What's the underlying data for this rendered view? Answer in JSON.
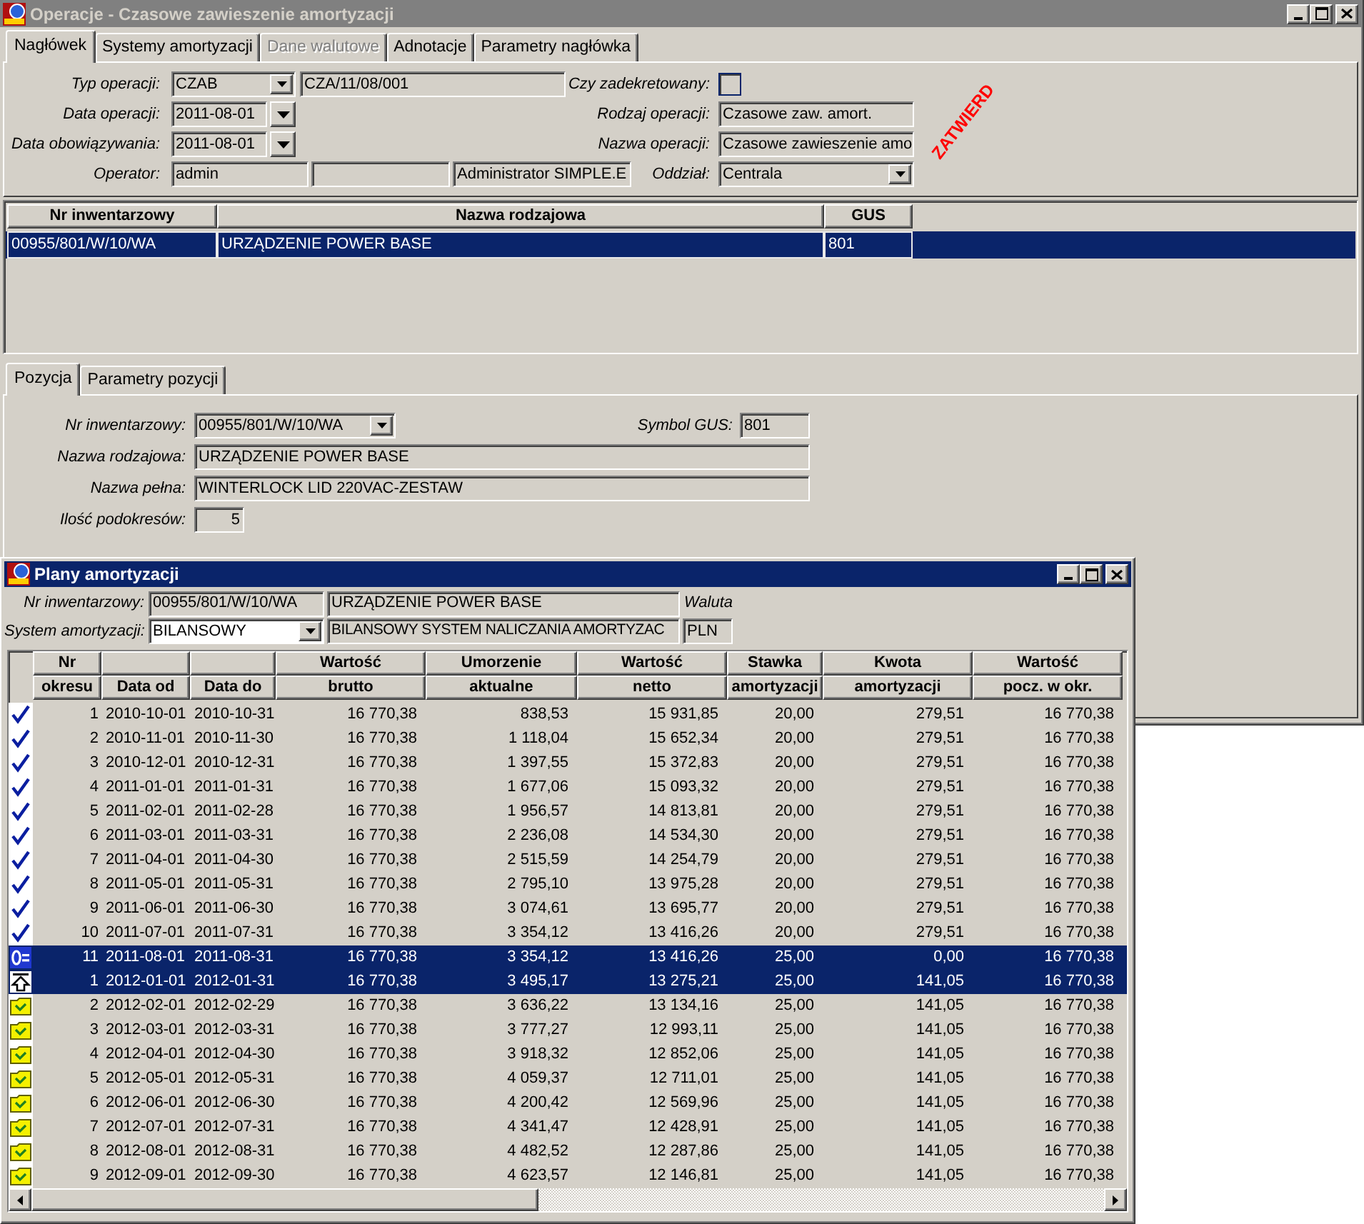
{
  "window": {
    "title": "Operacje - Czasowe zawieszenie amortyzacji",
    "active": false
  },
  "tabs": [
    {
      "label": "Nagłówek",
      "selected": true,
      "disabled": false
    },
    {
      "label": "Systemy amortyzacji",
      "selected": false,
      "disabled": false
    },
    {
      "label": "Dane walutowe",
      "selected": false,
      "disabled": true
    },
    {
      "label": "Adnotacje",
      "selected": false,
      "disabled": false
    },
    {
      "label": "Parametry nagłówka",
      "selected": false,
      "disabled": false
    }
  ],
  "header": {
    "typ_operacji": {
      "label": "Typ operacji:",
      "value": "CZAB",
      "document_number": "CZA/11/08/001"
    },
    "data_operacji": {
      "label": "Data operacji:",
      "value": "2011-08-01"
    },
    "data_obowiazywania": {
      "label": "Data obowiązywania:",
      "value": "2011-08-01"
    },
    "operator": {
      "label": "Operator:",
      "login": "admin",
      "full_name": "Administrator SIMPLE.E"
    },
    "czy_zadekretowany": {
      "label": "Czy zadekretowany:",
      "checked": false
    },
    "rodzaj_operacji": {
      "label": "Rodzaj operacji:",
      "value": "Czasowe zaw. amort."
    },
    "nazwa_operacji": {
      "label": "Nazwa operacji:",
      "value": "Czasowe zawieszenie amo"
    },
    "oddzial": {
      "label": "Oddział:",
      "value": "Centrala"
    },
    "stamp": "ZATWIERD"
  },
  "items_table": {
    "columns": [
      "Nr inwentarzowy",
      "Nazwa rodzajowa",
      "GUS"
    ],
    "rows": [
      {
        "selected": true,
        "cells": [
          "00955/801/W/10/WA",
          "URZĄDZENIE POWER BASE",
          "801"
        ]
      }
    ]
  },
  "position_tabs": [
    {
      "label": "Pozycja",
      "selected": true
    },
    {
      "label": "Parametry pozycji",
      "selected": false
    }
  ],
  "position": {
    "nr_inwentarzowy": {
      "label": "Nr inwentarzowy:",
      "value": "00955/801/W/10/WA"
    },
    "symbol_gus": {
      "label": "Symbol GUS:",
      "value": "801"
    },
    "nazwa_rodzajowa": {
      "label": "Nazwa rodzajowa:",
      "value": "URZĄDZENIE POWER BASE"
    },
    "nazwa_pelna": {
      "label": "Nazwa pełna:",
      "value": "WINTERLOCK LID 220VAC-ZESTAW"
    },
    "ilosc_podokresow": {
      "label": "Ilość podokresów:",
      "value": "5"
    }
  },
  "plans_window": {
    "title": "Plany amortyzacji",
    "active": true,
    "nr_inwentarzowy": {
      "label": "Nr inwentarzowy:",
      "value": "00955/801/W/10/WA",
      "name": "URZĄDZENIE POWER BASE"
    },
    "waluta": {
      "label": "Waluta",
      "value": "PLN"
    },
    "system_amortyzacji": {
      "label": "System amortyzacji:",
      "value": "BILANSOWY",
      "description": "BILANSOWY SYSTEM NALICZANIA AMORTYZAC"
    },
    "table": {
      "columns": [
        {
          "top": "Nr",
          "bottom": "okresu"
        },
        {
          "bottom": "Data od"
        },
        {
          "bottom": "Data do"
        },
        {
          "top": "Wartość",
          "bottom": "brutto"
        },
        {
          "top": "Umorzenie",
          "bottom": "aktualne"
        },
        {
          "top": "Wartość",
          "bottom": "netto"
        },
        {
          "top": "Stawka",
          "bottom": "amortyzacji"
        },
        {
          "top": "Kwota",
          "bottom": "amortyzacji"
        },
        {
          "top": "Wartość",
          "bottom": "pocz. w okr."
        }
      ],
      "rows": [
        {
          "kind": "settled",
          "selected": false,
          "cells": [
            "1",
            "2010-10-01",
            "2010-10-31",
            "16 770,38",
            "838,53",
            "15 931,85",
            "20,00",
            "279,51",
            "16 770,38"
          ]
        },
        {
          "kind": "settled",
          "selected": false,
          "cells": [
            "2",
            "2010-11-01",
            "2010-11-30",
            "16 770,38",
            "1 118,04",
            "15 652,34",
            "20,00",
            "279,51",
            "16 770,38"
          ]
        },
        {
          "kind": "settled",
          "selected": false,
          "cells": [
            "3",
            "2010-12-01",
            "2010-12-31",
            "16 770,38",
            "1 397,55",
            "15 372,83",
            "20,00",
            "279,51",
            "16 770,38"
          ]
        },
        {
          "kind": "settled",
          "selected": false,
          "cells": [
            "4",
            "2011-01-01",
            "2011-01-31",
            "16 770,38",
            "1 677,06",
            "15 093,32",
            "20,00",
            "279,51",
            "16 770,38"
          ]
        },
        {
          "kind": "settled",
          "selected": false,
          "cells": [
            "5",
            "2011-02-01",
            "2011-02-28",
            "16 770,38",
            "1 956,57",
            "14 813,81",
            "20,00",
            "279,51",
            "16 770,38"
          ]
        },
        {
          "kind": "settled",
          "selected": false,
          "cells": [
            "6",
            "2011-03-01",
            "2011-03-31",
            "16 770,38",
            "2 236,08",
            "14 534,30",
            "20,00",
            "279,51",
            "16 770,38"
          ]
        },
        {
          "kind": "settled",
          "selected": false,
          "cells": [
            "7",
            "2011-04-01",
            "2011-04-30",
            "16 770,38",
            "2 515,59",
            "14 254,79",
            "20,00",
            "279,51",
            "16 770,38"
          ]
        },
        {
          "kind": "settled",
          "selected": false,
          "cells": [
            "8",
            "2011-05-01",
            "2011-05-31",
            "16 770,38",
            "2 795,10",
            "13 975,28",
            "20,00",
            "279,51",
            "16 770,38"
          ]
        },
        {
          "kind": "settled",
          "selected": false,
          "cells": [
            "9",
            "2011-06-01",
            "2011-06-30",
            "16 770,38",
            "3 074,61",
            "13 695,77",
            "20,00",
            "279,51",
            "16 770,38"
          ]
        },
        {
          "kind": "settled",
          "selected": false,
          "cells": [
            "10",
            "2011-07-01",
            "2011-07-31",
            "16 770,38",
            "3 354,12",
            "13 416,26",
            "20,00",
            "279,51",
            "16 770,38"
          ]
        },
        {
          "kind": "current",
          "selected": true,
          "cells": [
            "11",
            "2011-08-01",
            "2011-08-31",
            "16 770,38",
            "3 354,12",
            "13 416,26",
            "25,00",
            "0,00",
            "16 770,38"
          ]
        },
        {
          "kind": "next",
          "selected": true,
          "cells": [
            "1",
            "2012-01-01",
            "2012-01-31",
            "16 770,38",
            "3 495,17",
            "13 275,21",
            "25,00",
            "141,05",
            "16 770,38"
          ]
        },
        {
          "kind": "planned",
          "selected": false,
          "cells": [
            "2",
            "2012-02-01",
            "2012-02-29",
            "16 770,38",
            "3 636,22",
            "13 134,16",
            "25,00",
            "141,05",
            "16 770,38"
          ]
        },
        {
          "kind": "planned",
          "selected": false,
          "cells": [
            "3",
            "2012-03-01",
            "2012-03-31",
            "16 770,38",
            "3 777,27",
            "12 993,11",
            "25,00",
            "141,05",
            "16 770,38"
          ]
        },
        {
          "kind": "planned",
          "selected": false,
          "cells": [
            "4",
            "2012-04-01",
            "2012-04-30",
            "16 770,38",
            "3 918,32",
            "12 852,06",
            "25,00",
            "141,05",
            "16 770,38"
          ]
        },
        {
          "kind": "planned",
          "selected": false,
          "cells": [
            "5",
            "2012-05-01",
            "2012-05-31",
            "16 770,38",
            "4 059,37",
            "12 711,01",
            "25,00",
            "141,05",
            "16 770,38"
          ]
        },
        {
          "kind": "planned",
          "selected": false,
          "cells": [
            "6",
            "2012-06-01",
            "2012-06-30",
            "16 770,38",
            "4 200,42",
            "12 569,96",
            "25,00",
            "141,05",
            "16 770,38"
          ]
        },
        {
          "kind": "planned",
          "selected": false,
          "cells": [
            "7",
            "2012-07-01",
            "2012-07-31",
            "16 770,38",
            "4 341,47",
            "12 428,91",
            "25,00",
            "141,05",
            "16 770,38"
          ]
        },
        {
          "kind": "planned",
          "selected": false,
          "cells": [
            "8",
            "2012-08-01",
            "2012-08-31",
            "16 770,38",
            "4 482,52",
            "12 287,86",
            "25,00",
            "141,05",
            "16 770,38"
          ]
        },
        {
          "kind": "planned",
          "selected": false,
          "cells": [
            "9",
            "2012-09-01",
            "2012-09-30",
            "16 770,38",
            "4 623,57",
            "12 146,81",
            "25,00",
            "141,05",
            "16 770,38"
          ]
        }
      ]
    }
  }
}
